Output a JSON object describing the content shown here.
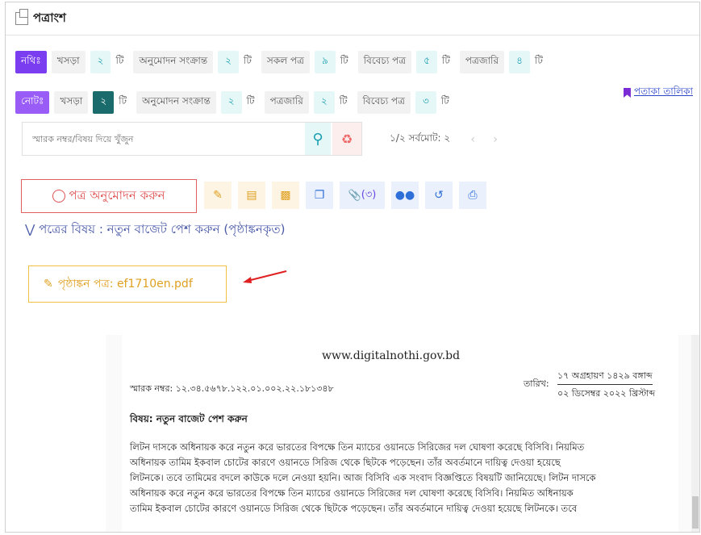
{
  "window": {
    "title": "পত্রাংশ"
  },
  "nothi_row": {
    "tag": "নথিঃ",
    "items": [
      {
        "label": "খসড়া",
        "count": "২",
        "unit": "টি"
      },
      {
        "label": "অনুমোদন সংক্রান্ত",
        "count": "২",
        "unit": "টি"
      },
      {
        "label": "সকল পত্র",
        "count": "৯",
        "unit": "টি"
      },
      {
        "label": "বিবেচ্য পত্র",
        "count": "৫",
        "unit": "টি"
      },
      {
        "label": "পত্রজারি",
        "count": "৪",
        "unit": "টি"
      }
    ]
  },
  "note_row": {
    "tag": "নোটঃ",
    "items": [
      {
        "label": "খসড়া",
        "count": "২",
        "unit": "টি"
      },
      {
        "label": "অনুমোদন সংক্রান্ত",
        "count": "২",
        "unit": "টি"
      },
      {
        "label": "পত্রজারি",
        "count": "২",
        "unit": "টি"
      },
      {
        "label": "বিবেচ্য পত্র",
        "count": "৩",
        "unit": "টি"
      }
    ],
    "flag_link": "পতাকা তালিকা"
  },
  "search": {
    "placeholder": "স্মারক নম্বর/বিষয় দিয়ে খুঁজুন",
    "icon": "search-icon",
    "reset_icon": "recycle-icon"
  },
  "pager": {
    "text": "১/২ সর্বমোট: ২",
    "prev": "‹",
    "next": "›"
  },
  "toolbar": {
    "approve_label": "পত্র অনুমোদন করুন",
    "attachment_count": "(৩)"
  },
  "subject": {
    "text": "পত্রের বিষয় : নতুন বাজেট পেশ করুন (পৃষ্ঠাঙ্কনকৃত)"
  },
  "attachment": {
    "label": "পৃষ্ঠাঙ্কন পত্র: ef1710en.pdf"
  },
  "document": {
    "site": "www.digitalnothi.gov.bd",
    "memo": "স্মারক নম্বর: ১২.৩৪.৫৬৭৮.১২২.০১.০০২.২২.১৮১৩৪৮",
    "date_label": "তারিখ:",
    "date_bn": "১৭ অগ্রহায়ণ ১৪২৯ বঙ্গাব্দ",
    "date_en": "০২ ডিসেম্বর ২০২২ খ্রিস্টাব্দ",
    "subject": "বিষয়: নতুন বাজেট পেশ করুন",
    "body": [
      "লিটন দাসকে অধিনায়ক করে নতুন করে ভারতের বিপক্ষে তিন ম্যাচের ওয়ানডে সিরিজের দল ঘোষণা করেছে বিসিবি। নিয়মিত",
      "অধিনায়ক তামিম ইকবাল চোটের কারণে ওয়ানডে সিরিজ থেকে ছিটকে পড়েছেন। তাঁর অবর্তমানে দায়িত্ব দেওয়া হয়েছে",
      "লিটনকে। তবে তামিমের বদলে কাউকে দলে নেওয়া হয়নি। আজ বিসিবি এক সংবাদ বিজ্ঞপ্তিতে বিষয়টি জানিয়েছে। লিটন দাসকে",
      "অধিনায়ক করে নতুন করে ভারতের বিপক্ষে তিন ম্যাচের ওয়ানডে সিরিজের দল ঘোষণা করেছে বিসিবি। নিয়মিত অধিনায়ক",
      "তামিম ইকবাল চোটের কারণে ওয়ানডে সিরিজ থেকে ছিটকে পড়েছেন। তাঁর অবর্তমানে দায়িত্ব দেওয়া হয়েছে লিটনকে। তবে"
    ]
  },
  "colors": {
    "tag": "#7a3df0",
    "count_bg": "#e6f7f8",
    "approve": "#e05050",
    "attach": "#e0a020"
  }
}
